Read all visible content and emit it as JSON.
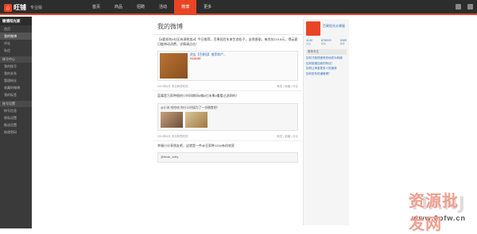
{
  "app": {
    "logo": "旺铺",
    "edition": "专业版"
  },
  "nav": [
    {
      "label": "首页"
    },
    {
      "label": "商品"
    },
    {
      "label": "招聘"
    },
    {
      "label": "活动"
    },
    {
      "label": "微博"
    },
    {
      "label": "更多"
    }
  ],
  "sidebar": {
    "title": "微博阳光家",
    "items": [
      "首页",
      "我的微博",
      "评论",
      "私信"
    ],
    "section1": "账号中心",
    "items2": [
      "我的账号",
      "我的关系",
      "管理粉丝",
      "收藏的微博",
      "我的标签"
    ],
    "section2": "账号设置",
    "items3": [
      "帐号信息",
      "隐私设置",
      "推送设置",
      "修改密码"
    ]
  },
  "main": {
    "title": "我的微博",
    "post1": "【#要如何#社区有源热卖#】今日推荐，百果园百年来生态松子，自然香甜，每克仅119.8元，得云夏日能带动消费，详情请点击！",
    "card_title": "进店【百果园】推荐商户...",
    "card_price": "¥119.80",
    "meta1_left": "2010年6月 来自阿里旺旺",
    "meta1_right": "转发 | 收藏 | 评论",
    "post2": "蓝莓是万家种植的小时间期间#微#红米果#重看过滤网吗！",
    "quote": "@小米 哈哈哈 你什么时候为了一份粮食吧！",
    "meta2_left": "2010年6月 来自阿里旺旺",
    "meta2_right": "转发 | 收藏 | 评论",
    "post3": "幸福小分享朋友吧，这就是一件@豆家种120#有机农家",
    "quote2": "@freak_xulty"
  },
  "profile": {
    "name": "百果阳光水果屋",
    "s1": "1132",
    "s1l": "关注",
    "s2": "876520",
    "s2l": "粉丝",
    "s3": "3469",
    "s3l": "微博",
    "side": "推荐关注",
    "links": [
      "如何才能快速有效地成为商铺",
      "如何能增加我的粉丝？",
      "如何让淘宝更多人知道我",
      "如何发布旺铺微博？"
    ]
  },
  "watermark": {
    "text": "TIANJ",
    "cn": "资源批发网",
    "url": "www.6pfw.cn"
  }
}
